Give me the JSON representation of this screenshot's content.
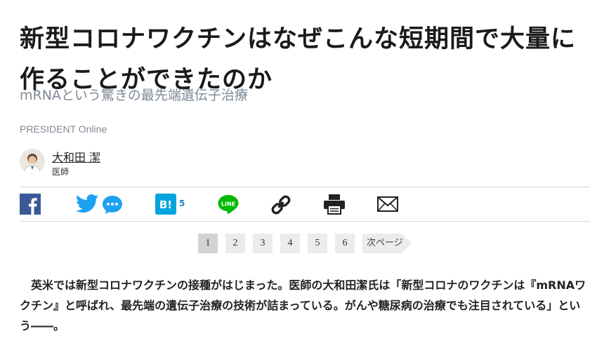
{
  "article": {
    "title": "新型コロナワクチンはなぜこんな短期間で大量に作ることができたのか",
    "subtitle": "mRNAという驚きの最先端遺伝子治療",
    "source": "PRESIDENT Online",
    "author_name": "大和田 潔",
    "author_role": "医師",
    "body": "英米では新型コロナワクチンの接種がはじまった。医師の大和田潔氏は「新型コロナのワクチンは『mRNAワクチン』と呼ばれ、最先端の遺伝子治療の技術が詰まっている。がんや糖尿病の治療でも注目されている」という――。"
  },
  "share": {
    "items": [
      {
        "name": "facebook-icon",
        "color": "#3b5998"
      },
      {
        "name": "twitter-icon",
        "color": "#1da1f2"
      },
      {
        "name": "hatena-bookmark-icon",
        "color": "#00a4de"
      },
      {
        "name": "line-icon",
        "color": "#00b900"
      },
      {
        "name": "link-icon",
        "color": "#222222"
      },
      {
        "name": "print-icon",
        "color": "#222222"
      },
      {
        "name": "mail-icon",
        "color": "#222222"
      }
    ],
    "hatena_count": "5"
  },
  "pagination": {
    "pages": [
      "1",
      "2",
      "3",
      "4",
      "5",
      "6"
    ],
    "current": "1",
    "next_label": "次ページ"
  }
}
